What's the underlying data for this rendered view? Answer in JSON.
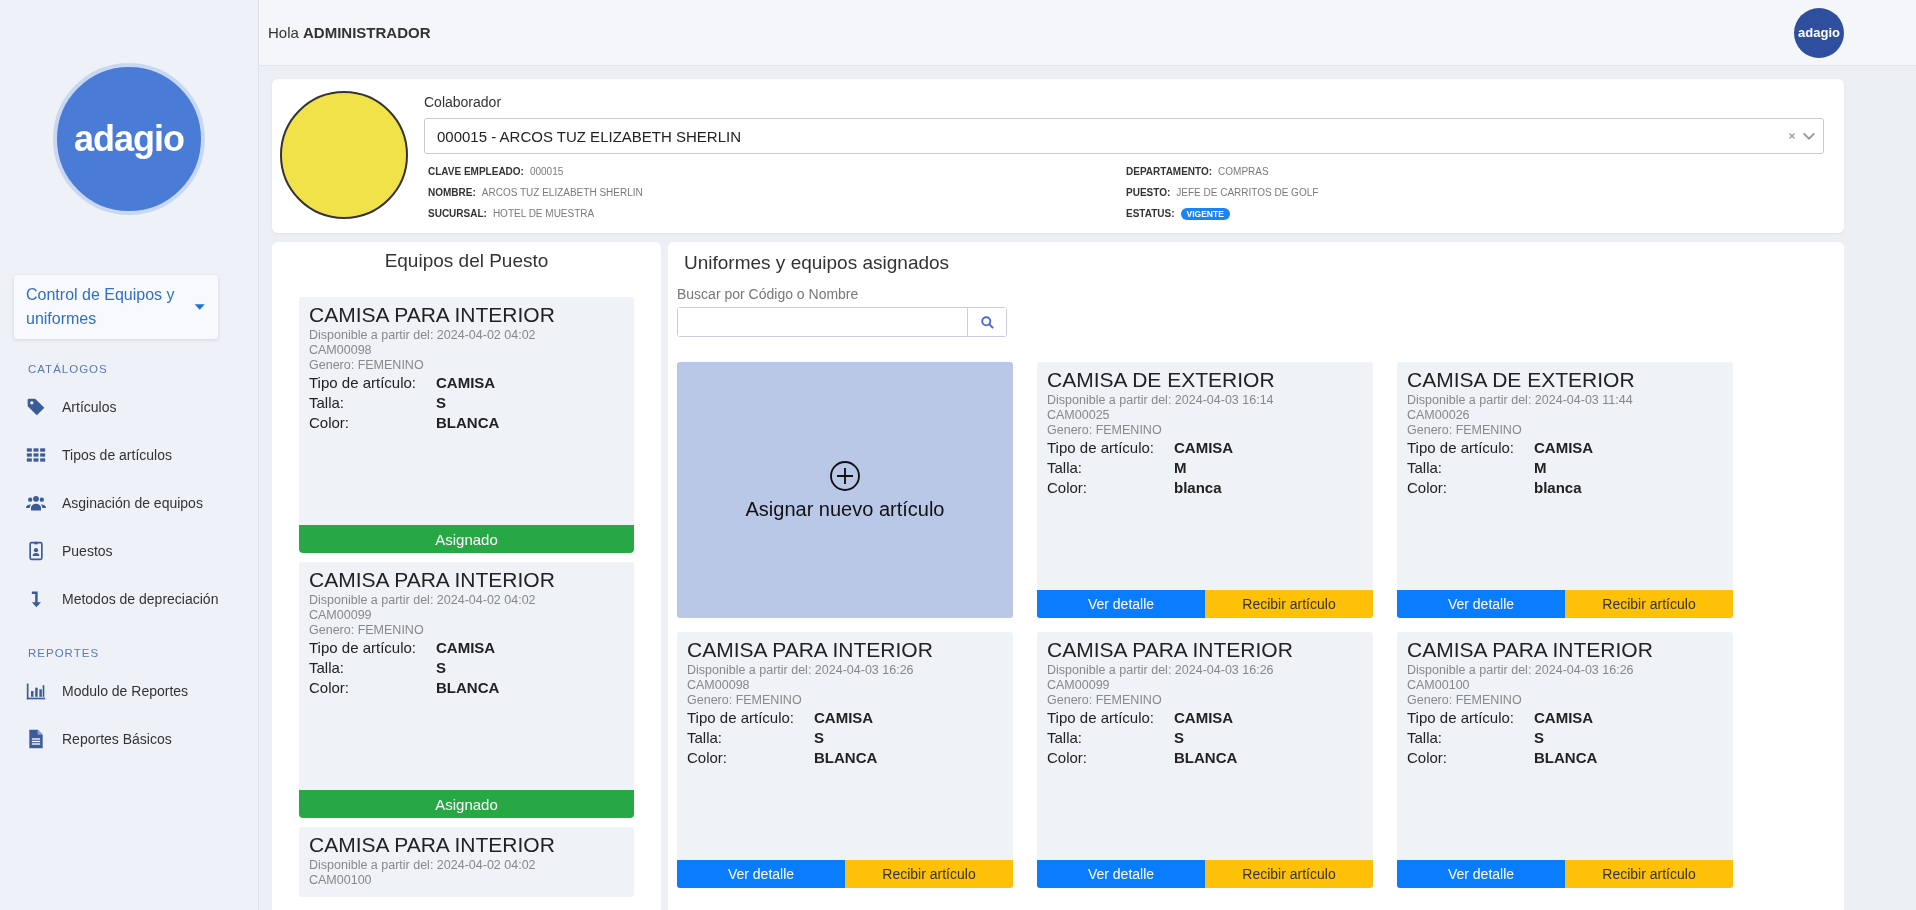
{
  "header": {
    "greeting": "Hola",
    "user": "ADMINISTRADOR",
    "logo": "adagio"
  },
  "sidebar": {
    "logo": "adagio",
    "module": "Control de Equipos y uniformes",
    "sections": [
      {
        "title": "CATÁLOGOS",
        "items": [
          {
            "label": "Artículos"
          },
          {
            "label": "Tipos de artículos"
          },
          {
            "label": "Asginación de equipos"
          },
          {
            "label": "Puestos"
          },
          {
            "label": "Metodos de depreciación"
          }
        ]
      },
      {
        "title": "REPORTES",
        "items": [
          {
            "label": "Modulo de Reportes"
          },
          {
            "label": "Reportes Básicos"
          }
        ]
      }
    ]
  },
  "profile": {
    "label": "Colaborador",
    "selected_value": "000015 - ARCOS TUZ ELIZABETH SHERLIN",
    "fields_left": [
      {
        "label": "CLAVE EMPLEADO:",
        "value": "000015"
      },
      {
        "label": "NOMBRE:",
        "value": "ARCOS TUZ ELIZABETH SHERLIN"
      },
      {
        "label": "SUCURSAL:",
        "value": "HOTEL DE MUESTRA"
      }
    ],
    "fields_right": [
      {
        "label": "DEPARTAMENTO:",
        "value": "COMPRAS"
      },
      {
        "label": "PUESTO:",
        "value": "JEFE DE CARRITOS DE GOLF"
      },
      {
        "label": "ESTATUS:",
        "badge": "VIGENTE"
      }
    ]
  },
  "position_equipment": {
    "title": "Equipos del Puesto",
    "items": [
      {
        "name": "CAMISA PARA INTERIOR",
        "available": "Disponible a partir del: 2024-04-02 04:02",
        "code": "CAM00098",
        "gender": "Genero: FEMENINO",
        "attributes": [
          {
            "label": "Tipo de artículo:",
            "value": "CAMISA"
          },
          {
            "label": "Talla:",
            "value": "S"
          },
          {
            "label": "Color:",
            "value": "BLANCA"
          }
        ],
        "status": "Asignado"
      },
      {
        "name": "CAMISA PARA INTERIOR",
        "available": "Disponible a partir del: 2024-04-02 04:02",
        "code": "CAM00099",
        "gender": "Genero: FEMENINO",
        "attributes": [
          {
            "label": "Tipo de artículo:",
            "value": "CAMISA"
          },
          {
            "label": "Talla:",
            "value": "S"
          },
          {
            "label": "Color:",
            "value": "BLANCA"
          }
        ],
        "status": "Asignado"
      },
      {
        "name": "CAMISA PARA INTERIOR",
        "available": "Disponible a partir del: 2024-04-02 04:02",
        "code": "CAM00100"
      }
    ]
  },
  "assigned": {
    "title": "Uniformes y equipos asignados",
    "search_label": "Buscar por Código o Nombre",
    "add_label": "Asignar nuevo artículo",
    "items": [
      {
        "name": "CAMISA DE EXTERIOR",
        "available": "Disponible a partir del: 2024-04-03 16:14",
        "code": "CAM00025",
        "gender": "Genero: FEMENINO",
        "attributes": [
          {
            "label": "Tipo de artículo:",
            "value": "CAMISA"
          },
          {
            "label": "Talla:",
            "value": "M"
          },
          {
            "label": "Color:",
            "value": "blanca"
          }
        ],
        "actions": [
          "Ver detalle",
          "Recibir artículo"
        ]
      },
      {
        "name": "CAMISA DE EXTERIOR",
        "available": "Disponible a partir del: 2024-04-03 11:44",
        "code": "CAM00026",
        "gender": "Genero: FEMENINO",
        "attributes": [
          {
            "label": "Tipo de artículo:",
            "value": "CAMISA"
          },
          {
            "label": "Talla:",
            "value": "M"
          },
          {
            "label": "Color:",
            "value": "blanca"
          }
        ],
        "actions": [
          "Ver detalle",
          "Recibir artículo"
        ]
      },
      {
        "name": "CAMISA PARA INTERIOR",
        "available": "Disponible a partir del: 2024-04-03 16:26",
        "code": "CAM00098",
        "gender": "Genero: FEMENINO",
        "attributes": [
          {
            "label": "Tipo de artículo:",
            "value": "CAMISA"
          },
          {
            "label": "Talla:",
            "value": "S"
          },
          {
            "label": "Color:",
            "value": "BLANCA"
          }
        ],
        "actions": [
          "Ver detalle",
          "Recibir artículo"
        ]
      },
      {
        "name": "CAMISA PARA INTERIOR",
        "available": "Disponible a partir del: 2024-04-03 16:26",
        "code": "CAM00099",
        "gender": "Genero: FEMENINO",
        "attributes": [
          {
            "label": "Tipo de artículo:",
            "value": "CAMISA"
          },
          {
            "label": "Talla:",
            "value": "S"
          },
          {
            "label": "Color:",
            "value": "BLANCA"
          }
        ],
        "actions": [
          "Ver detalle",
          "Recibir artículo"
        ]
      },
      {
        "name": "CAMISA PARA INTERIOR",
        "available": "Disponible a partir del: 2024-04-03 16:26",
        "code": "CAM00100",
        "gender": "Genero: FEMENINO",
        "attributes": [
          {
            "label": "Tipo de artículo:",
            "value": "CAMISA"
          },
          {
            "label": "Talla:",
            "value": "S"
          },
          {
            "label": "Color:",
            "value": "BLANCA"
          }
        ],
        "actions": [
          "Ver detalle",
          "Recibir artículo"
        ]
      }
    ]
  }
}
